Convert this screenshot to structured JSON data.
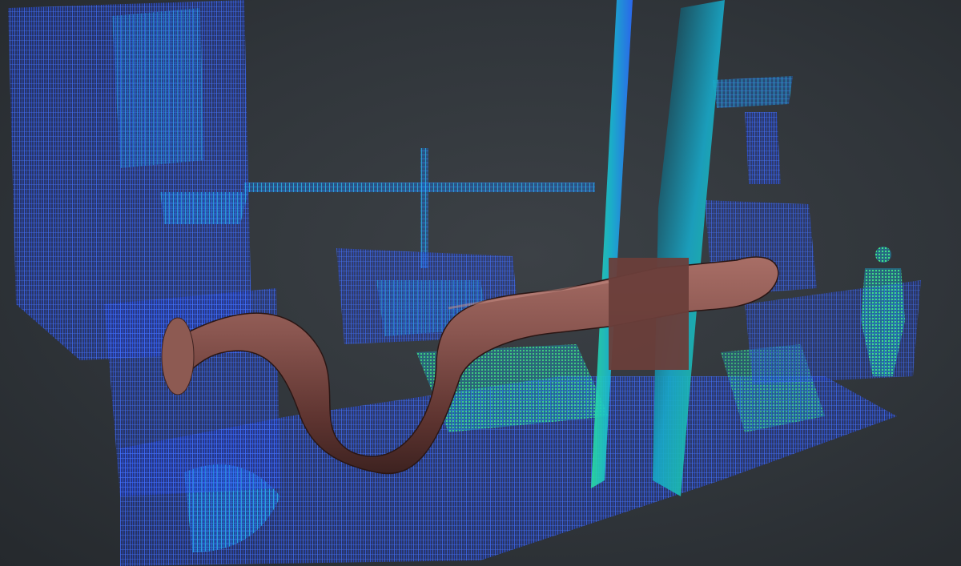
{
  "scene": {
    "description_label": "",
    "colors": {
      "background_center": "#3c4146",
      "background_edge": "#25292d",
      "point_cloud_blue": "#2a5cff",
      "point_cloud_cyan": "#19c8f0",
      "point_cloud_green": "#3cf07a",
      "pipe_body": "#7a4a44",
      "pipe_highlight": "#b07a70",
      "pipe_shadow": "#3d2220"
    },
    "objects": [
      {
        "name": "left-tower-structure",
        "kind": "point-cloud"
      },
      {
        "name": "horizontal-beam",
        "kind": "point-cloud"
      },
      {
        "name": "vertical-post",
        "kind": "point-cloud"
      },
      {
        "name": "center-machinery",
        "kind": "point-cloud"
      },
      {
        "name": "floor-equipment",
        "kind": "point-cloud"
      },
      {
        "name": "cross-section-plane-left",
        "kind": "clipping-plane"
      },
      {
        "name": "cross-section-plane-right",
        "kind": "clipping-plane"
      },
      {
        "name": "right-rack-structure",
        "kind": "point-cloud"
      },
      {
        "name": "worker-figure",
        "kind": "point-cloud"
      },
      {
        "name": "modeled-pipe",
        "kind": "cad-mesh"
      }
    ]
  }
}
